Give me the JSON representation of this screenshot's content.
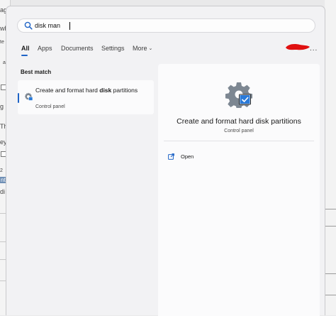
{
  "search": {
    "value": "disk man"
  },
  "tabs": [
    {
      "label": "All",
      "active": true
    },
    {
      "label": "Apps"
    },
    {
      "label": "Documents"
    },
    {
      "label": "Settings"
    },
    {
      "label": "More"
    }
  ],
  "more_options_label": "...",
  "best_match": {
    "heading": "Best match",
    "title_prefix": "Create and format hard ",
    "title_highlight": "disk",
    "title_suffix": " partitions",
    "subtitle": "Control panel"
  },
  "details": {
    "title": "Create and format hard disk partitions",
    "subtitle": "Control panel",
    "actions": [
      {
        "label": "Open",
        "icon": "open-external-icon"
      }
    ]
  },
  "background": {
    "left_fragments": [
      "ag",
      "wh",
      "te",
      "a",
      "g",
      "Th",
      "ey",
      "2",
      "nt",
      "di"
    ]
  },
  "colors": {
    "accent": "#1e63c6",
    "annotation_red": "#e01010",
    "panel_bg": "#f2f2f4",
    "card_bg": "#fbfbfc"
  }
}
